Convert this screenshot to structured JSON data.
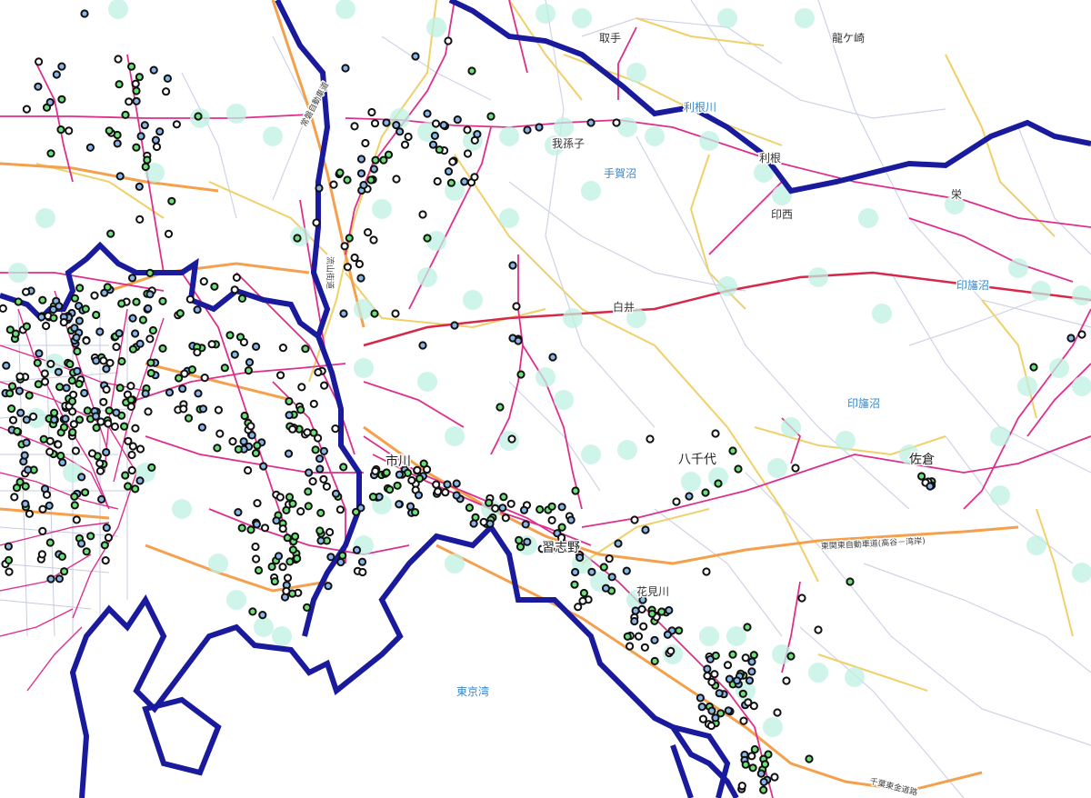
{
  "colors": {
    "boundary": "#1a1a9c",
    "rail": "#dd2f8c",
    "expressway": "#f4a04c",
    "road": "#f0d068",
    "local_road": "#cfd3e6",
    "shinkansen": "#d6284a",
    "halo": "#bff0e2",
    "station_green": "#6fe07a",
    "station_blue": "#8ab6e8",
    "station_white": "#ffffff",
    "water_label": "#3a87c8"
  },
  "labels": {
    "toride": "取手",
    "ryugasaki": "龍ケ崎",
    "abiko": "我孫子",
    "teganuma": "手賀沼",
    "tone_river": "利根川",
    "tone": "利根",
    "inzai": "印西",
    "sakae": "栄",
    "shiroi": "白井",
    "inba_numa_1": "印旛沼",
    "inba_numa_2": "印旛沼",
    "yachiyo": "八千代",
    "sakura": "佐倉",
    "ichikawa": "市川",
    "funabashi": "船橋",
    "narashino": "習志野",
    "hanamigawa": "花見川",
    "tokyo_bay": "東京湾",
    "joban_expressway": "常磐自動車道",
    "nagareyama_road": "流山街道",
    "higashikanto_expressway": "東関東自動車道(高谷－湾岸)",
    "chibatogane_road": "千葉東金道路"
  },
  "icons": {
    "station_marker": "station-circle-icon",
    "coverage_halo": "coverage-halo-icon"
  }
}
